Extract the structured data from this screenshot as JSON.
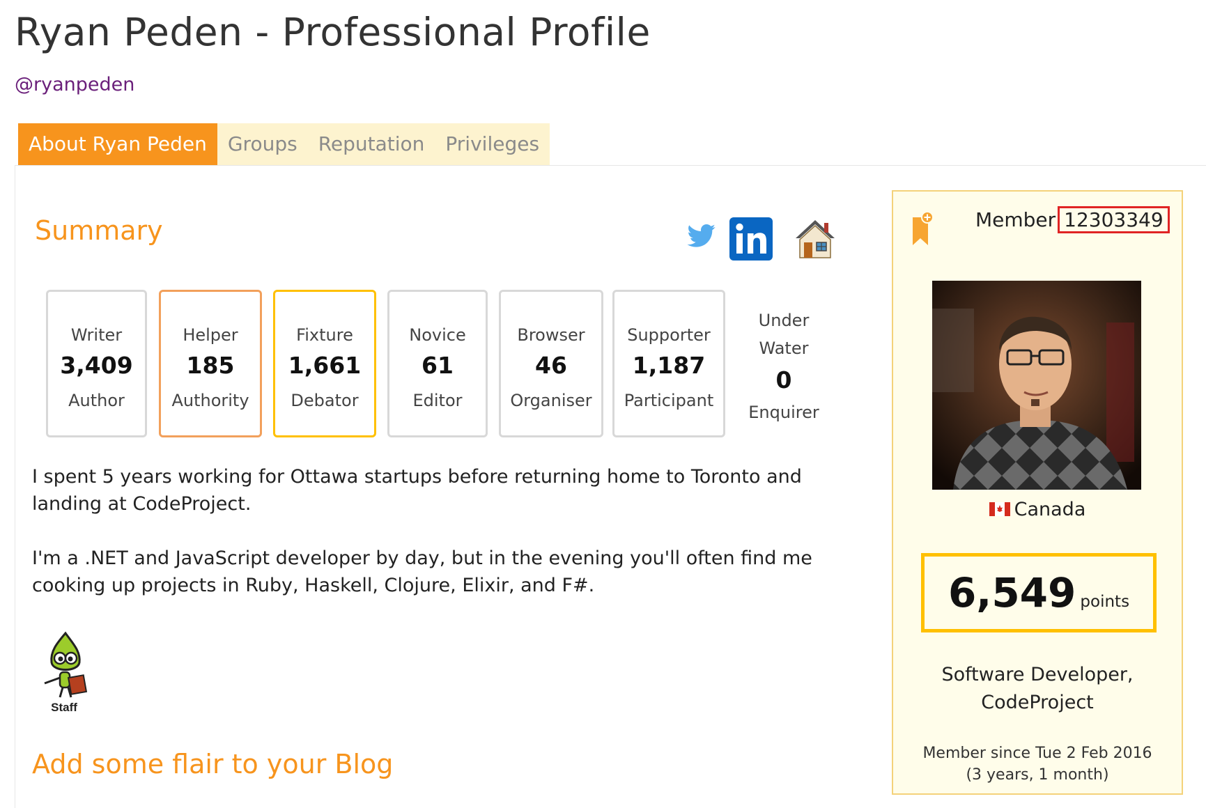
{
  "page_title": "Ryan Peden - Professional Profile",
  "handle": "@ryanpeden",
  "tabs": [
    {
      "label": "About Ryan Peden",
      "active": true
    },
    {
      "label": "Groups",
      "active": false
    },
    {
      "label": "Reputation",
      "active": false
    },
    {
      "label": "Privileges",
      "active": false
    }
  ],
  "summary": {
    "heading": "Summary",
    "social_icons": [
      "twitter-icon",
      "linkedin-icon",
      "home-icon"
    ]
  },
  "badges": [
    {
      "title": "Writer",
      "count": "3,409",
      "subtitle": "Author",
      "color": "#d8d8d8"
    },
    {
      "title": "Helper",
      "count": "185",
      "subtitle": "Authority",
      "color": "#f2a05b"
    },
    {
      "title": "Fixture",
      "count": "1,661",
      "subtitle": "Debator",
      "color": "#ffc000"
    },
    {
      "title": "Novice",
      "count": "61",
      "subtitle": "Editor",
      "color": "#d8d8d8"
    },
    {
      "title": "Browser",
      "count": "46",
      "subtitle": "Organiser",
      "color": "#d8d8d8"
    },
    {
      "title": "Supporter",
      "count": "1,187",
      "subtitle": "Participant",
      "color": "#d8d8d8"
    }
  ],
  "underwater": {
    "line1": "Under",
    "line2": "Water",
    "count": "0",
    "subtitle": "Enquirer"
  },
  "bio": [
    "I spent 5 years working for Ottawa startups before returning home to Toronto and landing at CodeProject.",
    "I'm a .NET and JavaScript developer by day, but in the evening you'll often find me cooking up projects in Ruby, Haskell, Clojure, Elixir, and F#."
  ],
  "staff_logo": {
    "label": "Staff"
  },
  "flair_heading": "Add some flair to your Blog",
  "sidebar": {
    "member_label": "Member",
    "member_id": "12303349",
    "country": "Canada",
    "points": "6,549",
    "points_unit": "points",
    "job_line1": "Software Developer,",
    "job_line2": "CodeProject",
    "member_since": "Member since Tue 2 Feb 2016",
    "member_duration": "(3 years, 1 month)"
  },
  "colors": {
    "accent_orange": "#f7941d",
    "tab_bg": "#fdf3cf",
    "sidebar_bg": "#fffdea",
    "gold": "#ffc000",
    "highlight_red": "#e02424",
    "handle_purple": "#6a1f7a"
  }
}
